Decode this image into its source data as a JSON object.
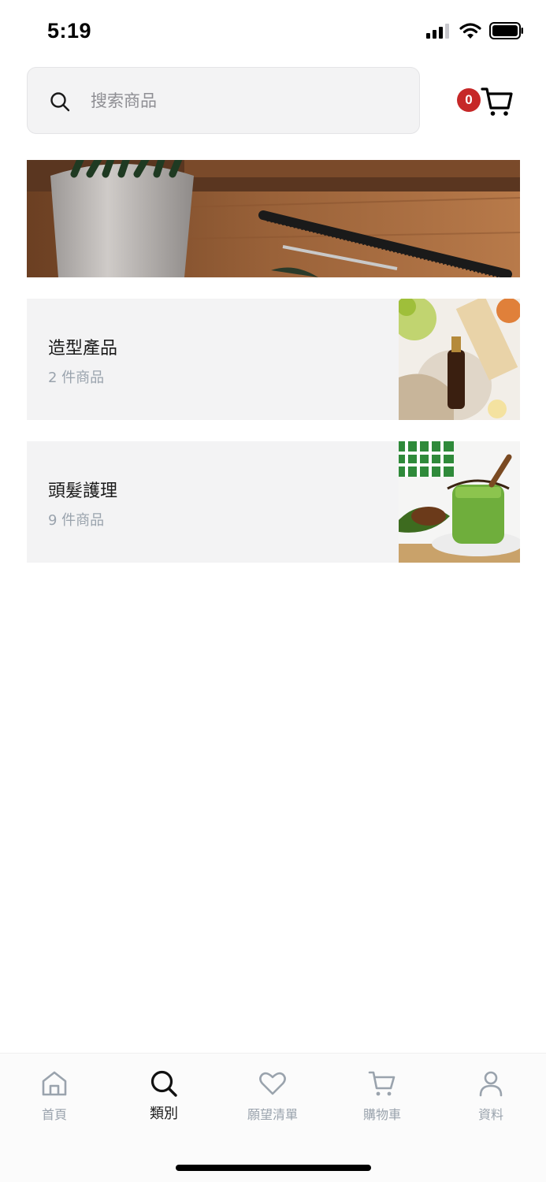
{
  "status_bar": {
    "time": "5:19"
  },
  "search": {
    "placeholder": "搜索商品",
    "value": ""
  },
  "cart": {
    "count": "0"
  },
  "categories": [
    {
      "name": "造型產品",
      "count": "2 件商品"
    },
    {
      "name": "頭髮護理",
      "count": "9 件商品"
    }
  ],
  "tab_bar": {
    "items": [
      {
        "label": "首頁",
        "icon": "home-icon"
      },
      {
        "label": "類別",
        "icon": "search-icon"
      },
      {
        "label": "願望清單",
        "icon": "heart-icon"
      },
      {
        "label": "購物車",
        "icon": "cart-icon"
      },
      {
        "label": "資料",
        "icon": "user-icon"
      }
    ],
    "active": "類別"
  },
  "colors": {
    "badge": "#c62828",
    "card_background": "#f3f3f4",
    "muted_text": "#9aa3ad",
    "active_tab": "#1a1a1a"
  }
}
